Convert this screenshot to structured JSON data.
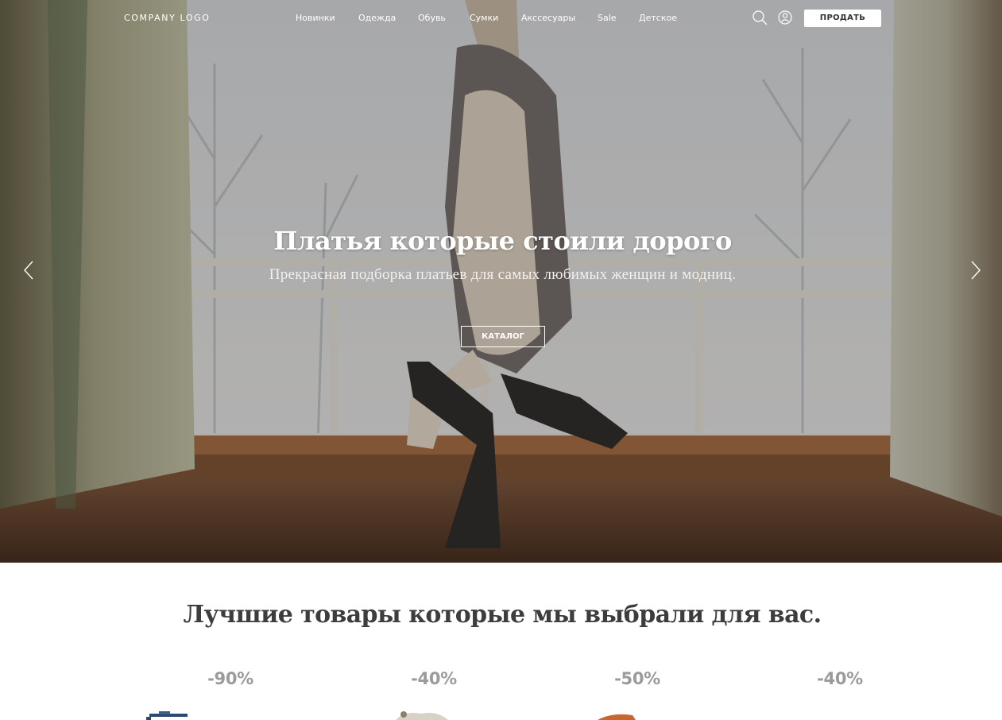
{
  "header": {
    "logo": "COMPANY LOGO",
    "nav": [
      "Новинки",
      "Одежда",
      "Обувь",
      "Сумки",
      "Акссесуары",
      "Sale",
      "Детское"
    ],
    "search_icon": "search-icon",
    "account_icon": "user-icon",
    "sell_label": "ПРОДАТЬ"
  },
  "hero": {
    "title": "Платья которые стоили дорого",
    "subtitle": "Прекрасная подборка платьев для самых любимых женщин и модниц.",
    "cta_label": "КАТАЛОГ",
    "prev_icon": "chevron-left-icon",
    "next_icon": "chevron-right-icon"
  },
  "featured": {
    "title": "Лучшие товары которые мы выбрали для вас.",
    "products": [
      {
        "discount": "-90%"
      },
      {
        "discount": "-40%"
      },
      {
        "discount": "-50%"
      },
      {
        "discount": "-40%"
      }
    ]
  },
  "colors": {
    "heading": "#3d3d3d",
    "discount": "#9b9b9b",
    "hero_text": "#ffffff"
  }
}
